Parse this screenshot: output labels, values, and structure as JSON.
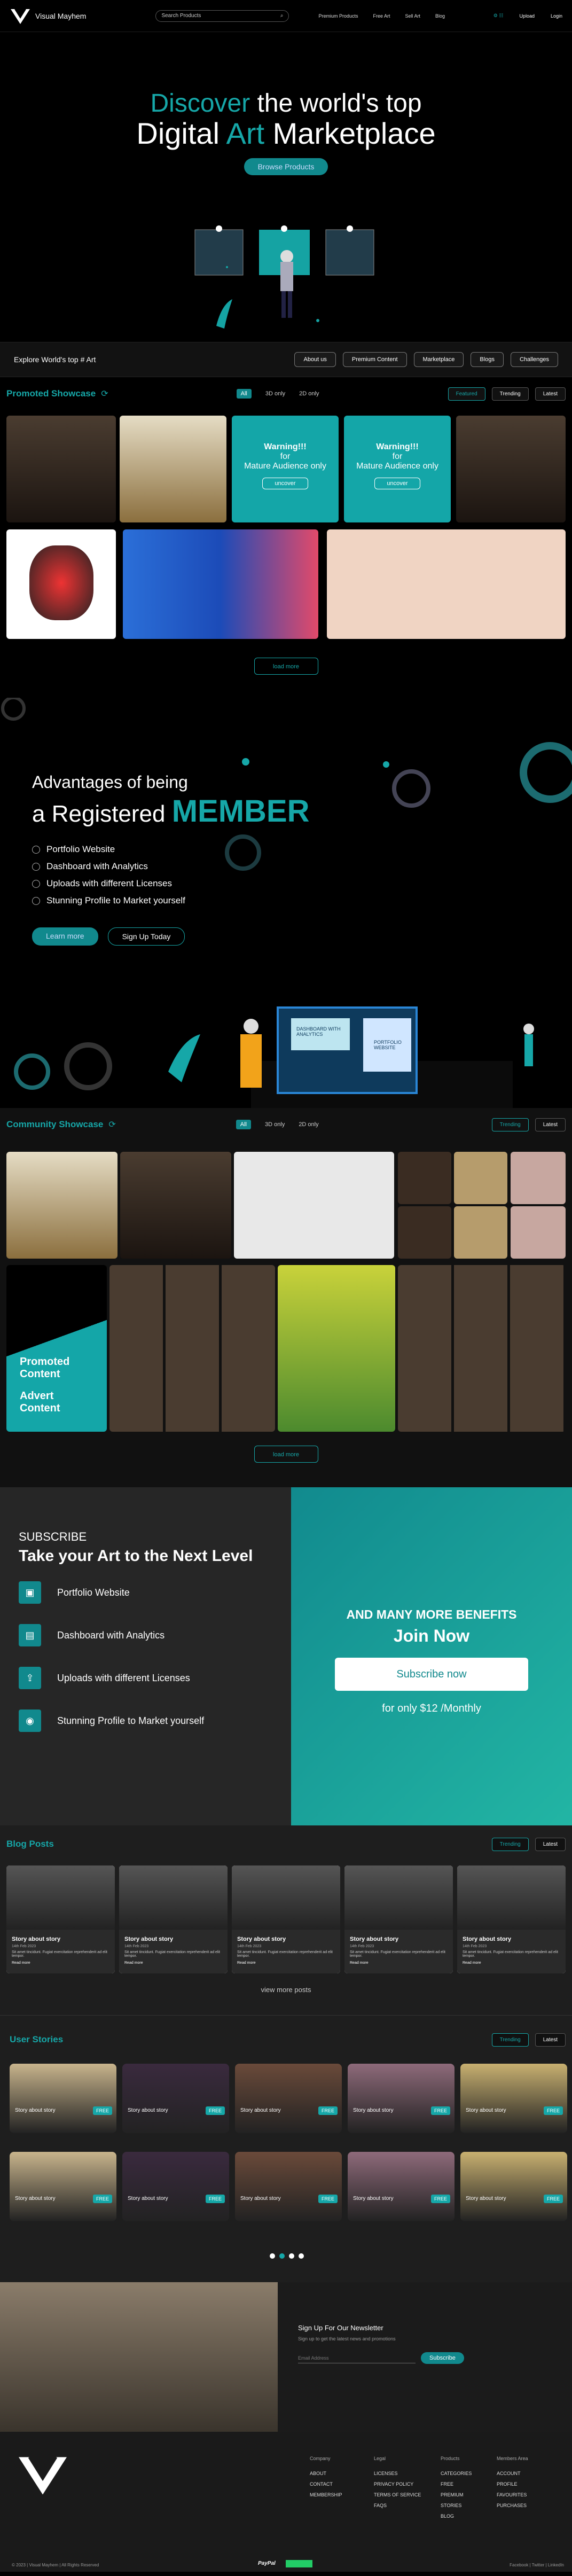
{
  "brand": {
    "name": "Visual Mayhem"
  },
  "nav": {
    "search_placeholder": "Search Products",
    "links": [
      "Premium Products",
      "Free Art",
      "Sell Art",
      "Blog"
    ],
    "right": [
      "",
      "Upload",
      "Login"
    ]
  },
  "hero": {
    "line1a": "Discover",
    "line1b": " the world's top",
    "line2a": "Digital ",
    "line2b": "Art",
    "line2c": " Marketplace",
    "cta": "Browse Products"
  },
  "explore": {
    "title": "Explore World's top # Art",
    "chips": [
      "About us",
      "Premium Content",
      "Marketplace",
      "Blogs",
      "Challenges"
    ]
  },
  "promoted": {
    "title": "Promoted Showcase",
    "tabs": [
      "All",
      "3D only",
      "2D only"
    ],
    "buttons": [
      "Featured",
      "Trending",
      "Latest"
    ],
    "warning": {
      "title": "Warning!!!",
      "line2": "for",
      "line3": "Mature Audience only",
      "btn": "uncover"
    },
    "loadmore": "load more"
  },
  "advantages": {
    "l1": "Advantages of being",
    "l2a": "a ",
    "l2b": "Registered ",
    "l2c": "MEMBER",
    "items": [
      "Portfolio Website",
      "Dashboard with Analytics",
      "Uploads with different Licenses",
      "Stunning Profile to Market yourself"
    ],
    "learn": "Learn more",
    "signup": "Sign Up Today",
    "panel1": "DASHBOARD WITH ANALYTICS",
    "panel2": "PORTFOLIO WEBSITE"
  },
  "community": {
    "title": "Community Showcase",
    "tabs": [
      "All",
      "3D only",
      "2D only"
    ],
    "buttons": [
      "Trending",
      "Latest"
    ],
    "promo1": "Promoted",
    "promo2": "Content",
    "promo3": "Advert",
    "promo4": "Content",
    "loadmore": "load more"
  },
  "subscribe": {
    "kicker": "SUBSCRIBE",
    "title": "Take your Art to the Next Level",
    "features": [
      "Portfolio Website",
      "Dashboard with Analytics",
      "Uploads with different Licenses",
      "Stunning Profile to Market yourself"
    ],
    "more": "AND MANY MORE BENEFITS",
    "join": "Join Now",
    "btn": "Subscribe now",
    "price": "for only $12 /Monthly"
  },
  "blog": {
    "title": "Blog Posts",
    "buttons": [
      "Trending",
      "Latest"
    ],
    "card_title": "Story about story",
    "card_date": "14th Feb 2023",
    "card_text": "Sit amet tincidunt. Fugiat exercitation reprehenderit ad elit tempor.",
    "read": "Read more",
    "viewmore": "view more posts"
  },
  "stories": {
    "title": "User Stories",
    "buttons": [
      "Trending",
      "Latest"
    ],
    "caption": "Story about story",
    "badge": "FREE"
  },
  "newsletter": {
    "title": "Sign Up For Our Newsletter",
    "sub": "Sign up to get the latest news and promotions",
    "placeholder": "Email Address",
    "btn": "Subscribe"
  },
  "footer": {
    "cols": [
      {
        "h": "Company",
        "items": [
          "ABOUT",
          "CONTACT",
          "MEMBERSHIP"
        ]
      },
      {
        "h": "Legal",
        "items": [
          "LICENSES",
          "PRIVACY POLICY",
          "TERMS OF SERVICE",
          "FAQS"
        ]
      },
      {
        "h": "Products",
        "items": [
          "CATEGORIES",
          "FREE",
          "PREMIUM",
          "STORIES",
          "BLOG"
        ]
      },
      {
        "h": "Members Area",
        "items": [
          "ACCOUNT",
          "PROFILE",
          "FAVOURITES",
          "PURCHASES"
        ]
      }
    ],
    "copyright": "© 2023 | Visual Mayhem | All Rights Reserved",
    "payment": "PayPal",
    "social": "Facebook | Twitter | LinkedIn"
  }
}
